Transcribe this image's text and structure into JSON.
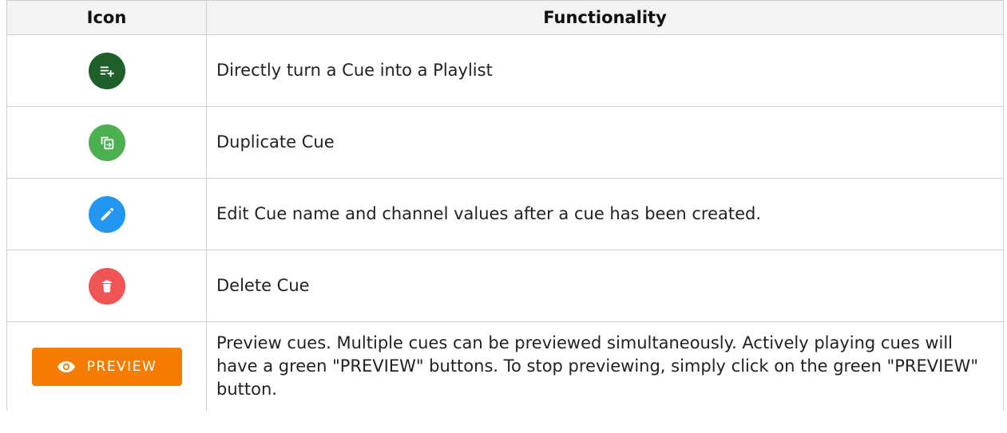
{
  "table": {
    "headers": {
      "icon": "Icon",
      "functionality": "Functionality"
    },
    "rows": [
      {
        "icon_name": "playlist-add-icon",
        "icon_color": "#1f5f2a",
        "functionality": "Directly turn a Cue into a Playlist"
      },
      {
        "icon_name": "duplicate-icon",
        "icon_color": "#4caf50",
        "functionality": "Duplicate Cue"
      },
      {
        "icon_name": "pencil-edit-icon",
        "icon_color": "#2196f3",
        "functionality": "Edit Cue name and channel values after a cue has been created."
      },
      {
        "icon_name": "trash-delete-icon",
        "icon_color": "#f05454",
        "functionality": "Delete Cue"
      },
      {
        "icon_name": "eye-icon",
        "button_label": "PREVIEW",
        "button_color": "#f57c00",
        "button_text_color": "#ffffff",
        "functionality": "Preview cues. Multiple cues can be previewed simultaneously. Actively playing cues will have a green \"PREVIEW\" buttons. To stop previewing, simply click on the green \"PREVIEW\" button."
      }
    ]
  }
}
